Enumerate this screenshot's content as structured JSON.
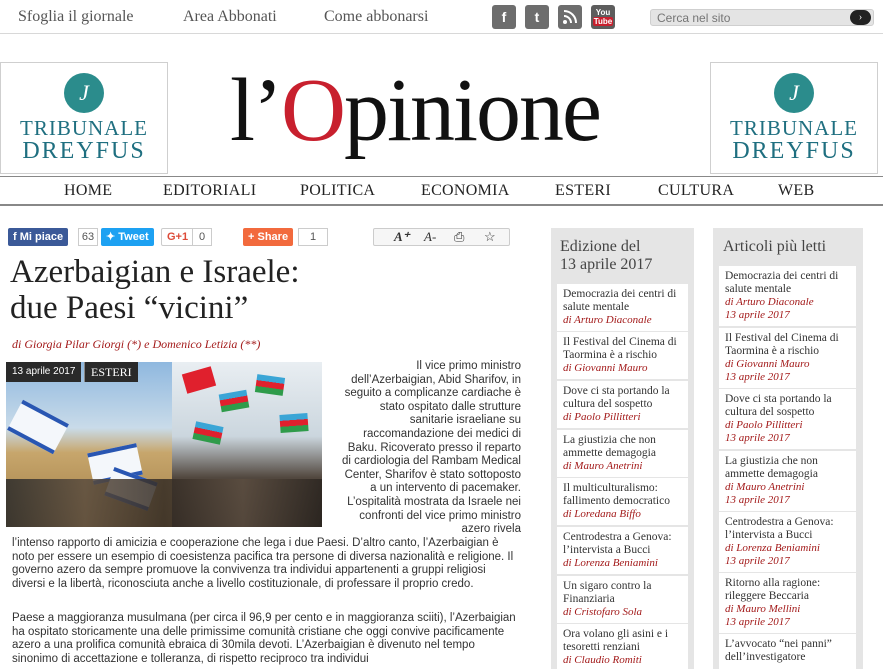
{
  "topbar": {
    "links": [
      "Sfoglia il giornale",
      "Area Abbonati",
      "Come abbonarsi"
    ],
    "social": {
      "facebook": "f",
      "twitter": "t",
      "youtube_top": "You",
      "youtube_bottom": "Tube"
    },
    "search_placeholder": "Cerca nel sito",
    "search_button": "›"
  },
  "banner": {
    "line1": "TRIBUNALE",
    "line2": "DREYFUS",
    "seal": "J"
  },
  "logo": {
    "part1": "l’",
    "part2": "O",
    "part3": "pinione"
  },
  "nav": [
    "HOME",
    "EDITORIALI",
    "POLITICA",
    "ECONOMIA",
    "ESTERI",
    "CULTURA",
    "WEB"
  ],
  "share": {
    "facebook_label": "Mi piace",
    "facebook_count": "63",
    "tweet_label": "Tweet",
    "gplus_label": "G+1",
    "gplus_count": "0",
    "share_label": "Share",
    "share_count": "1",
    "tools": {
      "font_up": "A⁺",
      "font_down": "A-",
      "print": "⎙",
      "bookmark": "☆"
    }
  },
  "article": {
    "title_line1": "Azerbaigian e Israele:",
    "title_line2": "due Paesi “vicini”",
    "byline": "di Giorgia Pilar Giorgi (*) e Domenico Letizia (**)",
    "date": "13 aprile 2017",
    "category": "ESTERI",
    "p1_top": "Il vice primo ministro dell’Azerbaigian, Abid Sharifov, in seguito a complicanze cardiache è stato ospitato dalle strutture sanitarie israeliane su raccomandazione dei medici di Baku. Ricoverato presso il reparto di cardiologia del Rambam Medical Center, Sharifov è stato sottoposto a un intervento di pacemaker. L’ospitalità mostrata da Israele nei confronti del vice primo ministro azero rivela",
    "p1_bottom": "l’intenso rapporto di amicizia e cooperazione che lega i due Paesi. D’altro canto, l’Azerbaigian è noto per essere un esempio di coesistenza pacifica tra persone di diversa nazionalità e religione. Il governo azero da sempre promuove la convivenza tra individui appartenenti a gruppi religiosi diversi e la libertà, riconosciuta anche a livello costituzionale, di professare il proprio credo.",
    "p2": "Paese a maggioranza musulmana (per circa il 96,9 per cento e in maggioranza sciiti), l’Azerbaigian ha ospitato storicamente una delle primissime comunità cristiane che oggi convive pacificamente azero a una prolifica comunità ebraica di 30mila devoti. L’Azerbaigian è divenuto nel tempo sinonimo di accettazione e tolleranza, di rispetto reciproco tra individui"
  },
  "edition": {
    "heading_line1": "Edizione del",
    "heading_line2": "13 aprile 2017",
    "items": [
      {
        "title": "Democrazia dei centri di salute mentale",
        "author": "di Arturo Diaconale"
      },
      {
        "title": "Il Festival del Cinema di Taormina è a rischio",
        "author": "di Giovanni Mauro"
      },
      {
        "title": "Dove ci sta portando la cultura del sospetto",
        "author": "di Paolo Pillitteri"
      },
      {
        "title": "La giustizia che non ammette demagogia",
        "author": "di Mauro Anetrini"
      },
      {
        "title": "Il multiculturalismo: fallimento democratico",
        "author": "di Loredana Biffo"
      },
      {
        "title": "Centrodestra a Genova: l’intervista a Bucci",
        "author": "di Lorenza Beniamini"
      },
      {
        "title": "Un sigaro contro la Finanziaria",
        "author": "di Cristofaro Sola"
      },
      {
        "title": "Ora volano gli asini e i tesoretti renziani",
        "author": "di Claudio Romiti"
      }
    ]
  },
  "most_read": {
    "heading": "Articoli più letti",
    "items": [
      {
        "title": "Democrazia dei centri di salute mentale",
        "author": "di Arturo Diaconale",
        "date": "13 aprile 2017"
      },
      {
        "title": "Il Festival del Cinema di Taormina è a rischio",
        "author": "di Giovanni Mauro",
        "date": "13 aprile 2017"
      },
      {
        "title": "Dove ci sta portando la cultura del sospetto",
        "author": "di Paolo Pillitteri",
        "date": "13 aprile 2017"
      },
      {
        "title": "La giustizia che non ammette demagogia",
        "author": "di Mauro Anetrini",
        "date": "13 aprile 2017"
      },
      {
        "title": "Centrodestra a Genova: l’intervista a Bucci",
        "author": "di Lorenza Beniamini",
        "date": "13 aprile 2017"
      },
      {
        "title": "Ritorno alla ragione: rileggere Beccaria",
        "author": "di Mauro Mellini",
        "date": "13 aprile 2017"
      },
      {
        "title": "L’avvocato “nei panni” dell’investigatore",
        "author": "",
        "date": ""
      }
    ]
  },
  "colors": {
    "accent_red": "#a31a1a",
    "logo_red": "#c8202e",
    "facebook": "#3b5998",
    "twitter": "#1da1f2",
    "gplus": "#dd4b39",
    "share": "#f26a3d"
  }
}
